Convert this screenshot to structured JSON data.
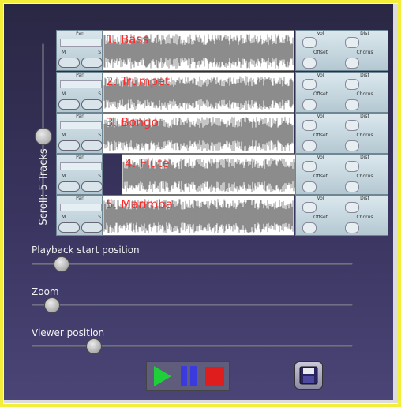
{
  "scroll": {
    "label": "Scroll: 5 Tracks",
    "level": 0.48
  },
  "tracks": [
    {
      "name": "1. Bass"
    },
    {
      "name": "2. Trumpet"
    },
    {
      "name": "3. Bongo"
    },
    {
      "name": "4. Flute"
    },
    {
      "name": "5. Marimba"
    }
  ],
  "left_controls": {
    "pan": "Pan",
    "mute": "M",
    "solo": "S"
  },
  "right_controls": {
    "vol": "Vol",
    "dist": "Dist",
    "offset": "Offset",
    "chorus": "Chorus"
  },
  "sliders": {
    "playback": {
      "label": "Playback start position",
      "value": 0.07
    },
    "zoom": {
      "label": "Zoom",
      "value": 0.04
    },
    "viewer": {
      "label": "Viewer position",
      "value": 0.17
    }
  },
  "transport": {
    "play_icon": "play-icon",
    "pause_icon": "pause-icon",
    "stop_icon": "stop-icon"
  },
  "save_icon": "floppy-disk-icon",
  "colors": {
    "accent_red": "#ff2a2a",
    "play_green": "#1fcf3a",
    "pause_blue": "#3a3adf",
    "stop_red": "#e01d1d",
    "frame_yellow": "#f2ee3a"
  }
}
